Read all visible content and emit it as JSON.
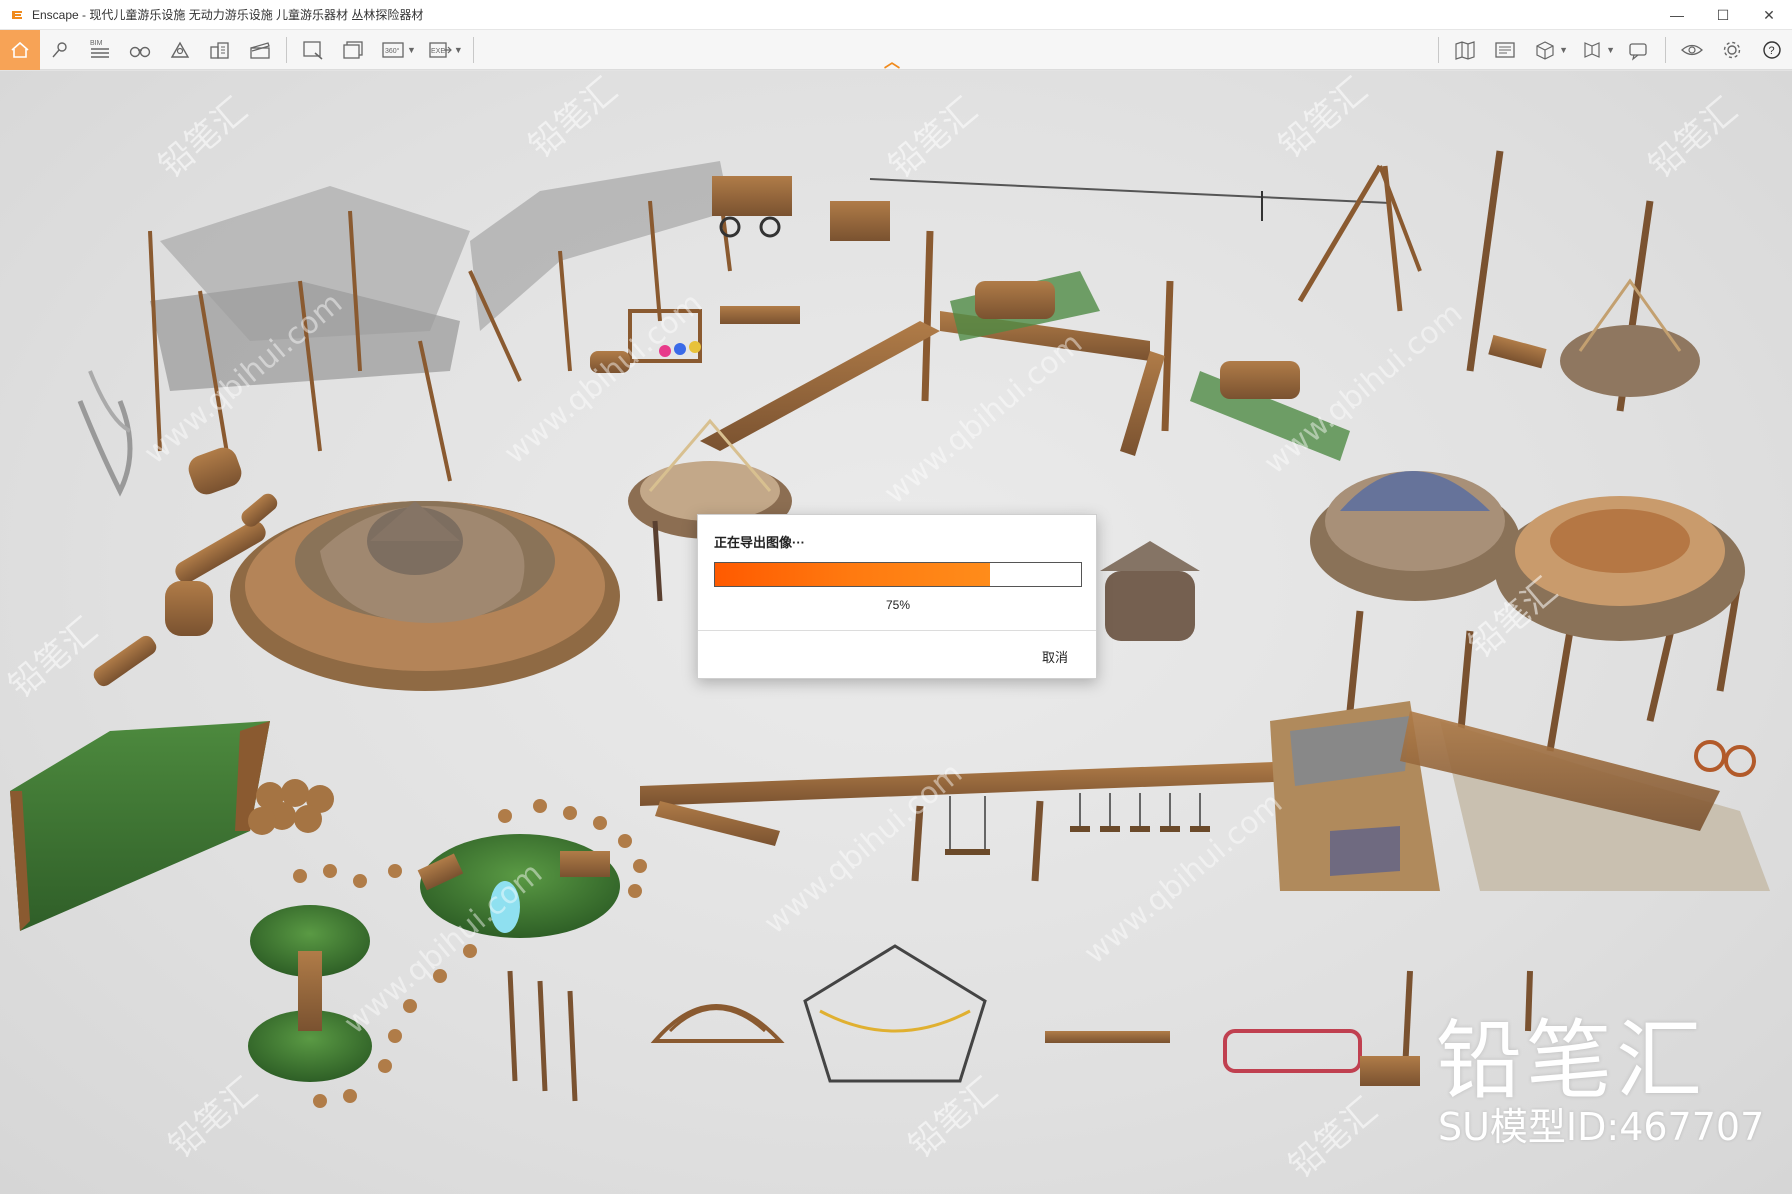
{
  "window": {
    "title": "Enscape - 现代儿童游乐设施 无动力游乐设施 儿童游乐器材 丛林探险器材",
    "minimize": "—",
    "maximize": "☐",
    "close": "✕"
  },
  "toolbar": {
    "bim_label": "BIM",
    "pano_label": "360°",
    "exe_label": "EXE",
    "help_label": "?"
  },
  "dialog": {
    "title": "正在导出图像···",
    "progress": 0.75,
    "progress_text": "75%",
    "cancel": "取消"
  },
  "watermark": {
    "brand": "铅笔汇",
    "model_id": "SU模型ID:467707",
    "tile_text": "铅笔汇",
    "tile_url": "www.qbihui.com"
  },
  "colors": {
    "accent": "#f7a356",
    "progress": "#ff6a00",
    "wood": "#9a6a3c",
    "grass": "#3f7a35"
  }
}
